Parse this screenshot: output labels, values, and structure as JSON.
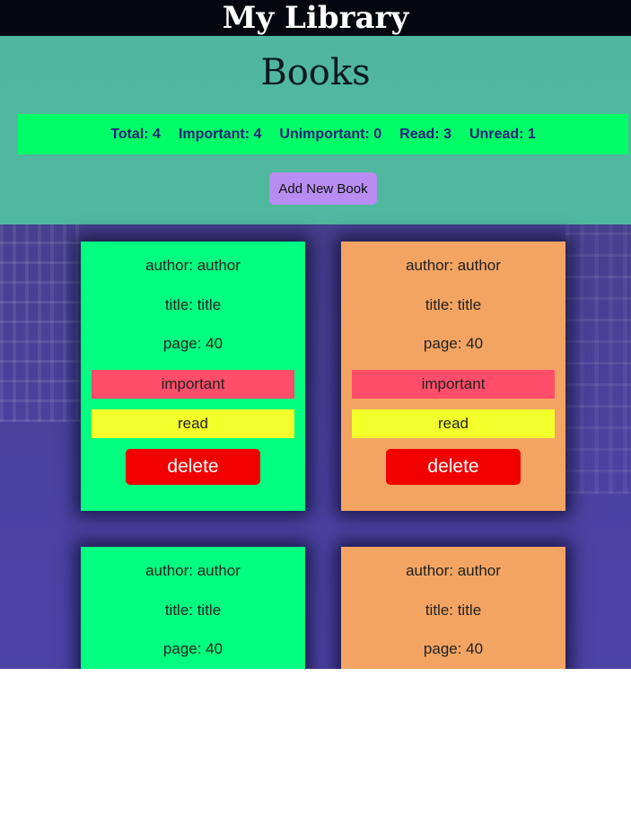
{
  "navbar": {
    "title": "My Library"
  },
  "header": {
    "title": "Books",
    "stats": {
      "total": "Total: 4",
      "important": "Important: 4",
      "unimportant": "Unimportant: 0",
      "read": "Read: 3",
      "unread": "Unread: 1"
    },
    "add_button": "Add New Book"
  },
  "colors": {
    "navbar_bg": "#05080f",
    "header_bg": "#52c8a0",
    "stats_bg": "#00ff66",
    "stats_text": "#1f1f7a",
    "add_button_bg": "#b88cf0",
    "card_green": "#00ff80",
    "card_orange": "#f3a462",
    "important_tag": "#ff4d6a",
    "read_tag": "#f2ff2a",
    "delete_button": "#f20000"
  },
  "books": [
    {
      "author": "author: author",
      "title": "title: title",
      "page": "page: 40",
      "importance": "important",
      "status": "read",
      "delete": "delete",
      "color": "green"
    },
    {
      "author": "author: author",
      "title": "title: title",
      "page": "page: 40",
      "importance": "important",
      "status": "read",
      "delete": "delete",
      "color": "orange"
    },
    {
      "author": "author: author",
      "title": "title: title",
      "page": "page: 40",
      "color": "green"
    },
    {
      "author": "author: author",
      "title": "title: title",
      "page": "page: 40",
      "color": "orange"
    }
  ]
}
